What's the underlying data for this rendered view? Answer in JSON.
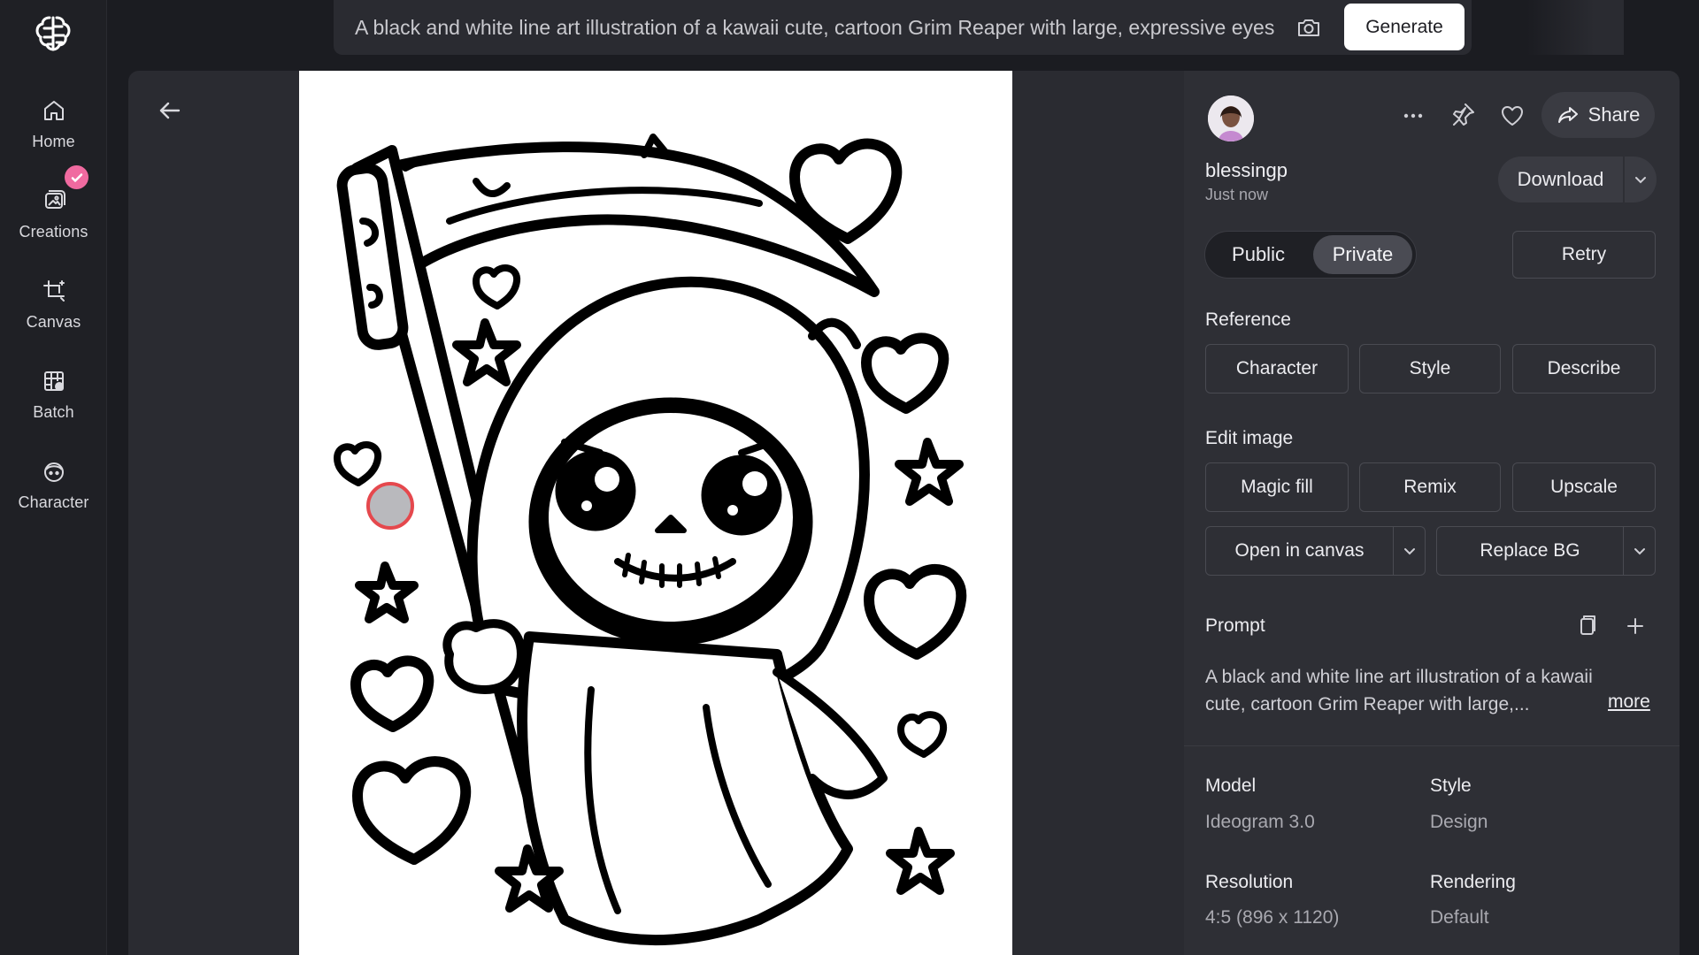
{
  "sidebar": {
    "items": [
      {
        "label": "Home",
        "icon": "home-icon"
      },
      {
        "label": "Creations",
        "icon": "image-stack-icon"
      },
      {
        "label": "Canvas",
        "icon": "crop-canvas-icon"
      },
      {
        "label": "Batch",
        "icon": "grid-image-icon"
      },
      {
        "label": "Character",
        "icon": "face-icon"
      }
    ],
    "badge_icon": "check-icon",
    "badge_color": "#f06aa0"
  },
  "prompt_bar": {
    "text": "A black and white line art illustration of a kawaii cute, cartoon Grim Reaper with large, expressive eyes",
    "generate_label": "Generate"
  },
  "post": {
    "username": "blessingp",
    "timestamp": "Just now",
    "share_label": "Share",
    "download_label": "Download",
    "visibility": {
      "public_label": "Public",
      "private_label": "Private",
      "selected": "Private"
    },
    "retry_label": "Retry"
  },
  "reference": {
    "title": "Reference",
    "buttons": [
      "Character",
      "Style",
      "Describe"
    ]
  },
  "edit_image": {
    "title": "Edit image",
    "buttons": [
      "Magic fill",
      "Remix",
      "Upscale"
    ],
    "open_in_canvas_label": "Open in canvas",
    "replace_bg_label": "Replace BG"
  },
  "prompt": {
    "title": "Prompt",
    "text": "A black and white line art illustration of a kawaii cute, cartoon Grim Reaper with large,...",
    "more_label": "more"
  },
  "meta": {
    "model_label": "Model",
    "model_value": "Ideogram 3.0",
    "style_label": "Style",
    "style_value": "Design",
    "resolution_label": "Resolution",
    "resolution_value": "4:5 (896 x 1120)",
    "rendering_label": "Rendering",
    "rendering_value": "Default"
  },
  "colors": {
    "background": "#1b1c21",
    "panel": "#2e2f35",
    "accent_pink": "#f06aa0",
    "cursor_ring": "#e5484d"
  }
}
